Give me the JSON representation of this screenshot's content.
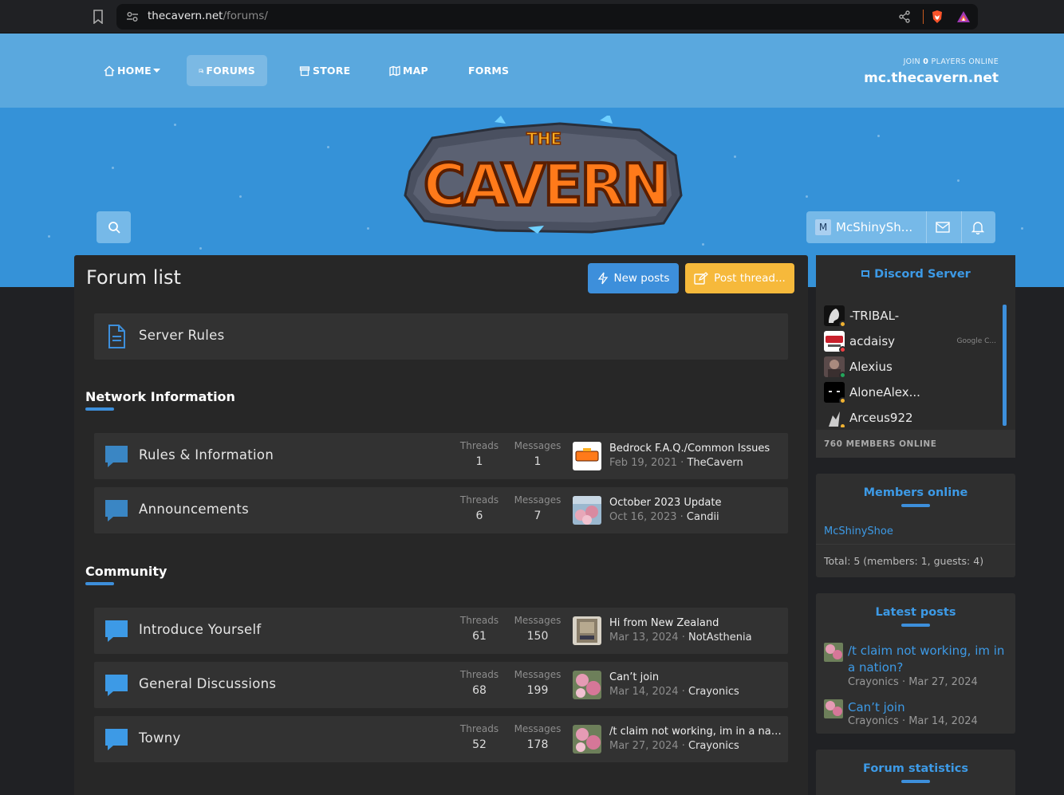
{
  "browser": {
    "url_domain": "thecavern.net",
    "url_path": "/forums/"
  },
  "nav": {
    "home": "HOME",
    "forums": "FORUMS",
    "store": "STORE",
    "map": "MAP",
    "forms": "FORMS"
  },
  "server": {
    "join_prefix": "JOIN",
    "players": "0",
    "join_suffix": "PLAYERS ONLINE",
    "ip": "mc.thecavern.net"
  },
  "logo_text": "THE CAVERN",
  "user": {
    "initial": "M",
    "name": "McShinySh..."
  },
  "page": {
    "title": "Forum list",
    "new_posts": "New posts",
    "post_thread": "Post thread..."
  },
  "standalone": {
    "title": "Server Rules"
  },
  "sections": [
    {
      "title": "Network Information"
    },
    {
      "title": "Community"
    }
  ],
  "stat_labels": {
    "threads": "Threads",
    "messages": "Messages"
  },
  "forums": [
    {
      "title": "Rules & Information",
      "threads": "1",
      "messages": "1",
      "last_title": "Bedrock F.A.Q./Common Issues",
      "last_date": "Feb 19, 2021",
      "last_user": "TheCavern"
    },
    {
      "title": "Announcements",
      "threads": "6",
      "messages": "7",
      "last_title": "October 2023 Update",
      "last_date": "Oct 16, 2023",
      "last_user": "Candii"
    },
    {
      "title": "Introduce Yourself",
      "threads": "61",
      "messages": "150",
      "last_title": "Hi from New Zealand",
      "last_date": "Mar 13, 2024",
      "last_user": "NotAsthenia"
    },
    {
      "title": "General Discussions",
      "threads": "68",
      "messages": "199",
      "last_title": "Can’t join",
      "last_date": "Mar 14, 2024",
      "last_user": "Crayonics"
    },
    {
      "title": "Towny",
      "threads": "52",
      "messages": "178",
      "last_title": "/t claim not working, im in a nation?",
      "last_date": "Mar 27, 2024",
      "last_user": "Crayonics"
    }
  ],
  "discord": {
    "title": "Discord Server",
    "members": [
      {
        "name": "-TRIBAL-",
        "game": "",
        "status_color": "#f0b232"
      },
      {
        "name": "acdaisy",
        "game": "Google C...",
        "status_color": "#f23f43"
      },
      {
        "name": "Alexius",
        "game": "",
        "status_color": "#23a55a"
      },
      {
        "name": "AloneAlex...",
        "game": "",
        "status_color": "#f0b232"
      },
      {
        "name": "Arceus922",
        "game": "",
        "status_color": "#f0b232"
      }
    ],
    "online_count": "760 MEMBERS ONLINE"
  },
  "members_online": {
    "title": "Members online",
    "members": [
      "McShinyShoe"
    ],
    "total": "Total: 5 (members: 1, guests: 4)"
  },
  "latest_posts": {
    "title": "Latest posts",
    "posts": [
      {
        "title": "/t claim not working, im in a nation?",
        "user": "Crayonics",
        "date": "Mar 27, 2024"
      },
      {
        "title": "Can’t join",
        "user": "Crayonics",
        "date": "Mar 14, 2024"
      }
    ]
  },
  "forum_statistics": {
    "title": "Forum statistics"
  },
  "colors": {
    "accent": "#3d8fdb",
    "header": "#5aa8de",
    "hero": "#3592d8",
    "post_button": "#f6b93b",
    "panel": "#272727"
  }
}
